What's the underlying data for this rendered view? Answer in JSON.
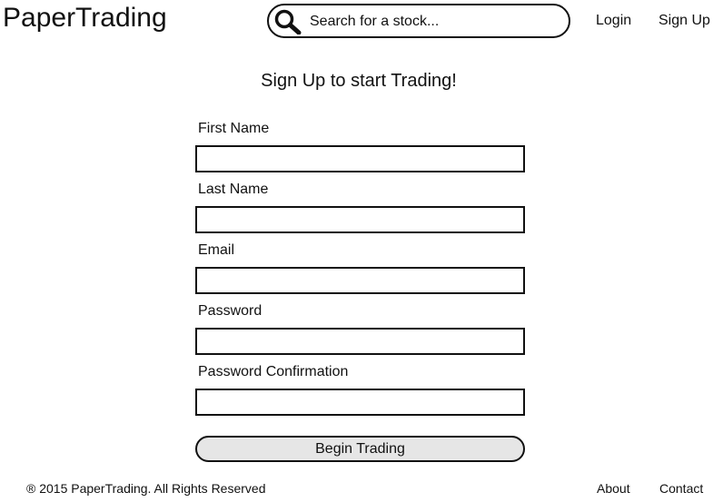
{
  "header": {
    "brand": "PaperTrading",
    "search": {
      "placeholder": "Search for a stock...",
      "icon": "search-icon"
    },
    "nav": {
      "login": "Login",
      "signup": "Sign Up"
    }
  },
  "main": {
    "heading": "Sign Up to start Trading!",
    "fields": [
      {
        "label": "First Name",
        "value": ""
      },
      {
        "label": "Last Name",
        "value": ""
      },
      {
        "label": "Email",
        "value": ""
      },
      {
        "label": "Password",
        "value": ""
      },
      {
        "label": "Password Confirmation",
        "value": ""
      }
    ],
    "submit_label": "Begin Trading"
  },
  "footer": {
    "copyright": "® 2015 PaperTrading. All Rights Reserved",
    "links": {
      "about": "About",
      "contact": "Contact"
    }
  }
}
